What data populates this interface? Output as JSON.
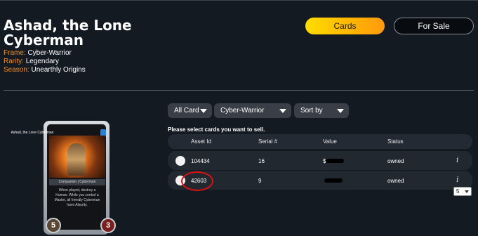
{
  "card_title": "Ashad, the Lone Cyberman",
  "meta": {
    "frame_key": "Frame:",
    "frame_value": "Cyber-Warrior",
    "rarity_key": "Rarity:",
    "rarity_value": "Legendary",
    "season_key": "Season:",
    "season_value": "Unearthly Origins"
  },
  "tabs": {
    "cards": "Cards",
    "for_sale": "For Sale"
  },
  "card_art": {
    "name": "Ashad, the Lone Cyberman",
    "type_line": "Companion | Cyberman",
    "text": "When played, destroy a Human. While you control a Master, all friendly Cyberman have Alacrity.",
    "left_stat": "5",
    "right_stat": "3"
  },
  "filters": {
    "all_card": "All Card",
    "frame": "Cyber-Warrior",
    "sort": "Sort by"
  },
  "instruction": "Please select cards you want to sell.",
  "table": {
    "headers": {
      "asset_id": "Asset Id",
      "serial": "Serial #",
      "value": "Value",
      "status": "Status"
    },
    "rows": [
      {
        "asset_id": "104434",
        "serial": "16",
        "value": "$",
        "status": "owned"
      },
      {
        "asset_id": "42603",
        "serial": "9",
        "value": "",
        "status": "owned"
      }
    ]
  },
  "page_size": "5",
  "icons": {
    "info": "info-icon",
    "caret": "chevron-down-icon"
  },
  "colors": {
    "accent": "#ffc400",
    "label": "#f08f2a",
    "background": "#141a22",
    "highlight": "#e01010"
  }
}
